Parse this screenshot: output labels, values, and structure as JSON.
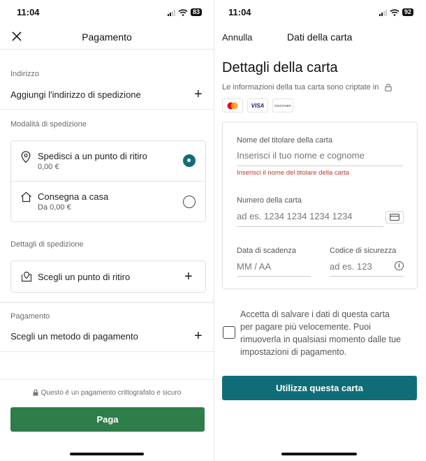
{
  "left": {
    "status": {
      "time": "11:04",
      "battery": "83"
    },
    "header": {
      "title": "Pagamento"
    },
    "address": {
      "label": "Indirizzo",
      "action": "Aggiungi l'indirizzo di spedizione"
    },
    "shipping_mode": {
      "label": "Modalità di spedizione",
      "options": [
        {
          "title": "Spedisci a un punto di ritiro",
          "price": "0,00 €",
          "selected": true
        },
        {
          "title": "Consegna a casa",
          "price": "Da 0,00 €",
          "selected": false
        }
      ]
    },
    "shipping_details": {
      "label": "Dettagli di spedizione",
      "action": "Scegli un punto di ritiro"
    },
    "payment": {
      "label": "Pagamento",
      "action": "Scegli un metodo di pagamento"
    },
    "secure_note": "Questo è un pagamento crittografato e sicuro",
    "pay_button": "Paga",
    "colors": {
      "pay_button": "#2f7d4a",
      "radio_selected": "#0f6d78"
    }
  },
  "right": {
    "status": {
      "time": "11:04",
      "battery": "92"
    },
    "header": {
      "cancel": "Annulla",
      "title": "Dati della carta"
    },
    "heading": "Dettagli della carta",
    "subtitle": "Le informazioni della tua carta sono criptate in",
    "card_brands": [
      "mastercard-logo",
      "visa-logo",
      "discover-logo"
    ],
    "card_brand_texts": {
      "visa": "VISA",
      "discover": "DISCOVER"
    },
    "holder": {
      "label": "Nome del titolare della carta",
      "placeholder": "Inserisci il tuo nome e cognome",
      "error": "Inserisci il nome del titolare della carta"
    },
    "number": {
      "label": "Numero della carta",
      "placeholder": "ad es. 1234 1234 1234 1234"
    },
    "expiry": {
      "label": "Data di scadenza",
      "placeholder": "MM / AA"
    },
    "cvc": {
      "label": "Codice di sicurezza",
      "placeholder": "ad es. 123"
    },
    "save_card": {
      "text_lines": [
        "Accetta di salvare i dati di questa carta",
        "per pagare più velocemente. Puoi",
        "rimuoverla in qualsiasi momento dalle tue",
        "impostazioni di pagamento."
      ],
      "checked": false
    },
    "use_button": "Utilizza questa carta",
    "colors": {
      "use_button": "#0f6d78",
      "error": "#c0392b"
    }
  }
}
